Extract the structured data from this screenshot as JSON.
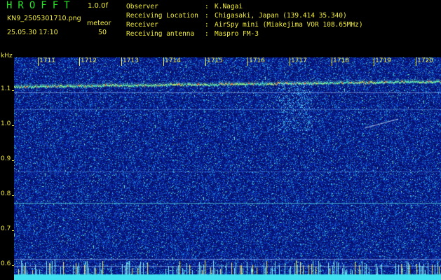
{
  "header": {
    "app_title": "HROFFT",
    "version": "1.0.0f",
    "filename": "KN9_2505301710.png",
    "timestamp": "25.05.30 17:10",
    "mode_label": "meteor",
    "mode_value": "50"
  },
  "meta": [
    {
      "key": "Observer",
      "value": "K.Nagai"
    },
    {
      "key": "Receiving Location",
      "value": "Chigasaki, Japan (139.414 35.340)"
    },
    {
      "key": "Receiver",
      "value": "AirSpy mini (Miakejima VOR 108.65MHz)"
    },
    {
      "key": "Receiving antenna",
      "value": "Maspro FM-3"
    }
  ],
  "axis": {
    "unit": "kHz",
    "y_ticks": [
      "1.1",
      "1.0",
      "0.9",
      "0.8",
      "0.7",
      "0.6"
    ],
    "time_labels": [
      "1711",
      "1712",
      "1713",
      "1714",
      "1715",
      "1716",
      "1717",
      "1718",
      "1719",
      "1720"
    ]
  },
  "colors": {
    "background": "#000000",
    "label": "#f3ee3a",
    "title": "#28e028",
    "noise": "#0a1ea0"
  }
}
